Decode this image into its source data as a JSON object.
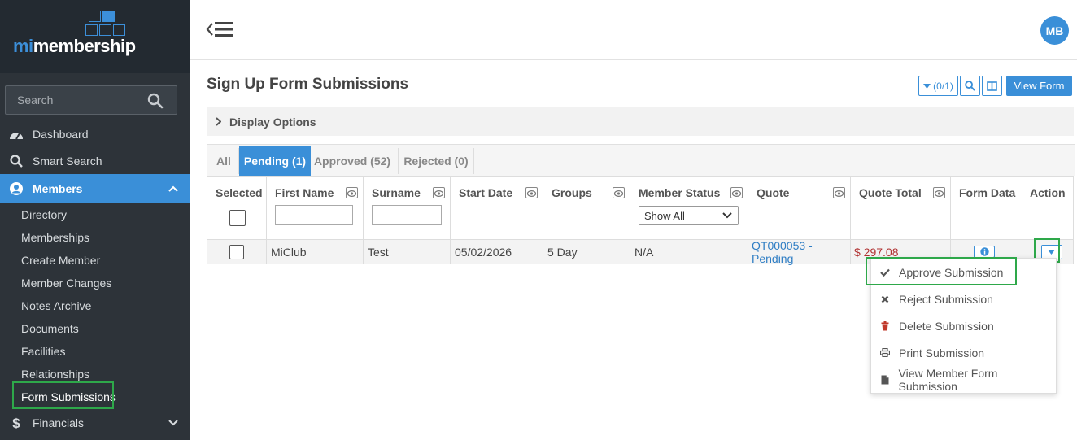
{
  "brand": {
    "prefix": "mi",
    "name": "membership"
  },
  "sidebar": {
    "search_placeholder": "Search",
    "nav": [
      {
        "label": "Dashboard",
        "icon": "dashboard-icon"
      },
      {
        "label": "Smart Search",
        "icon": "search-icon"
      },
      {
        "label": "Members",
        "icon": "user-icon",
        "active": true
      },
      {
        "label": "Financials",
        "icon": "dollar-icon"
      }
    ],
    "members_sub": [
      "Directory",
      "Memberships",
      "Create Member",
      "Member Changes",
      "Notes Archive",
      "Documents",
      "Facilities",
      "Relationships",
      "Form Submissions"
    ]
  },
  "header": {
    "avatar_initials": "MB"
  },
  "page": {
    "title": "Sign Up Form Submissions",
    "filter_count": "(0/1)",
    "view_form_label": "View Form",
    "display_options_label": "Display Options"
  },
  "tabs": [
    "All",
    "Pending (1)",
    "Approved (52)",
    "Rejected (0)"
  ],
  "table": {
    "headers": [
      "Selected",
      "First Name",
      "Surname",
      "Start Date",
      "Groups",
      "Member Status",
      "Quote",
      "Quote Total",
      "Form Data",
      "Action"
    ],
    "member_status_filter": "Show All",
    "rows": [
      {
        "first_name": "MiClub",
        "surname": "Test",
        "start_date": "05/02/2026",
        "groups": "5 Day",
        "member_status": "N/A",
        "quote": "QT000053 - Pending",
        "quote_total": "$ 297.08"
      }
    ]
  },
  "action_menu": [
    {
      "label": "Approve Submission",
      "icon": "check-icon"
    },
    {
      "label": "Reject Submission",
      "icon": "x-icon"
    },
    {
      "label": "Delete Submission",
      "icon": "trash-icon"
    },
    {
      "label": "Print Submission",
      "icon": "printer-icon"
    },
    {
      "label": "View Member Form Submission",
      "icon": "file-icon"
    }
  ],
  "colors": {
    "sidebar": "#2d3339",
    "accent": "#3a8fd8",
    "highlight": "#2ea84a"
  }
}
